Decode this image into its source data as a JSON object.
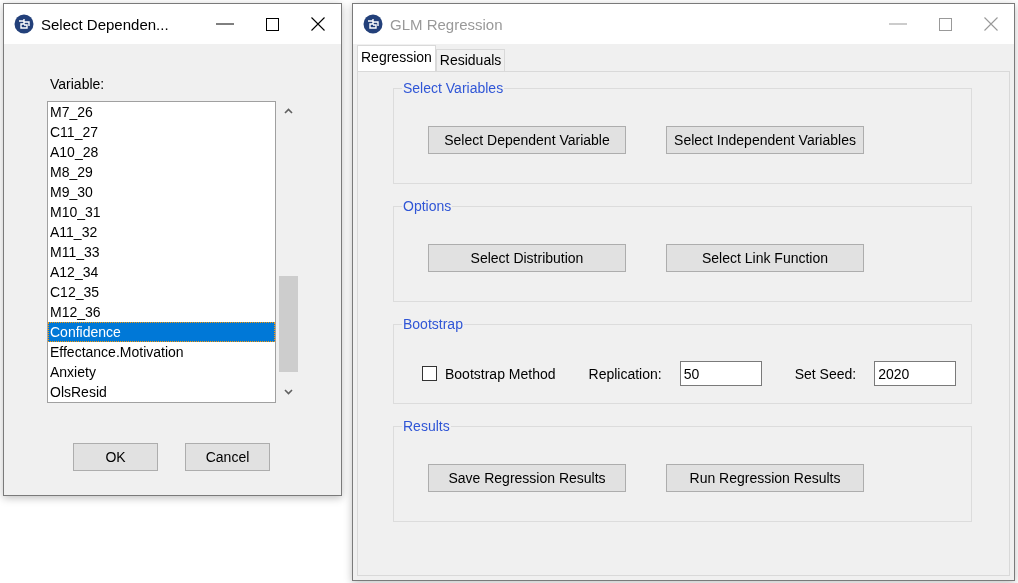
{
  "dialog": {
    "title": "Select Dependen...",
    "list_label": "Variable:",
    "items": [
      {
        "label": "M7_26",
        "selected": false
      },
      {
        "label": "C11_27",
        "selected": false
      },
      {
        "label": "A10_28",
        "selected": false
      },
      {
        "label": "M8_29",
        "selected": false
      },
      {
        "label": "M9_30",
        "selected": false
      },
      {
        "label": "M10_31",
        "selected": false
      },
      {
        "label": "A11_32",
        "selected": false
      },
      {
        "label": "M11_33",
        "selected": false
      },
      {
        "label": "A12_34",
        "selected": false
      },
      {
        "label": "C12_35",
        "selected": false
      },
      {
        "label": "M12_36",
        "selected": false
      },
      {
        "label": "Confidence",
        "selected": true
      },
      {
        "label": "Effectance.Motivation",
        "selected": false
      },
      {
        "label": "Anxiety",
        "selected": false
      },
      {
        "label": "OlsResid",
        "selected": false
      }
    ],
    "buttons": [
      "OK",
      "Cancel"
    ]
  },
  "main": {
    "title": "GLM Regression",
    "tabs": [
      {
        "label": "Regression",
        "selected": true
      },
      {
        "label": "Residuals",
        "selected": false
      }
    ],
    "groups": [
      {
        "kind": "buttons",
        "title": "Select Variables",
        "buttons": [
          "Select Dependent Variable",
          "Select Independent Variables"
        ]
      },
      {
        "kind": "buttons",
        "title": "Options",
        "buttons": [
          "Select Distribution",
          "Select Link Function"
        ]
      },
      {
        "kind": "bootstrap",
        "title": "Bootstrap",
        "checkbox": {
          "label": "Bootstrap Method",
          "checked": false
        },
        "fields": [
          {
            "label": "Replication:",
            "value": "50"
          },
          {
            "label": "Set Seed:",
            "value": "2020"
          }
        ]
      },
      {
        "kind": "buttons",
        "title": "Results",
        "buttons": [
          "Save Regression Results",
          "Run Regression Results"
        ]
      }
    ]
  }
}
